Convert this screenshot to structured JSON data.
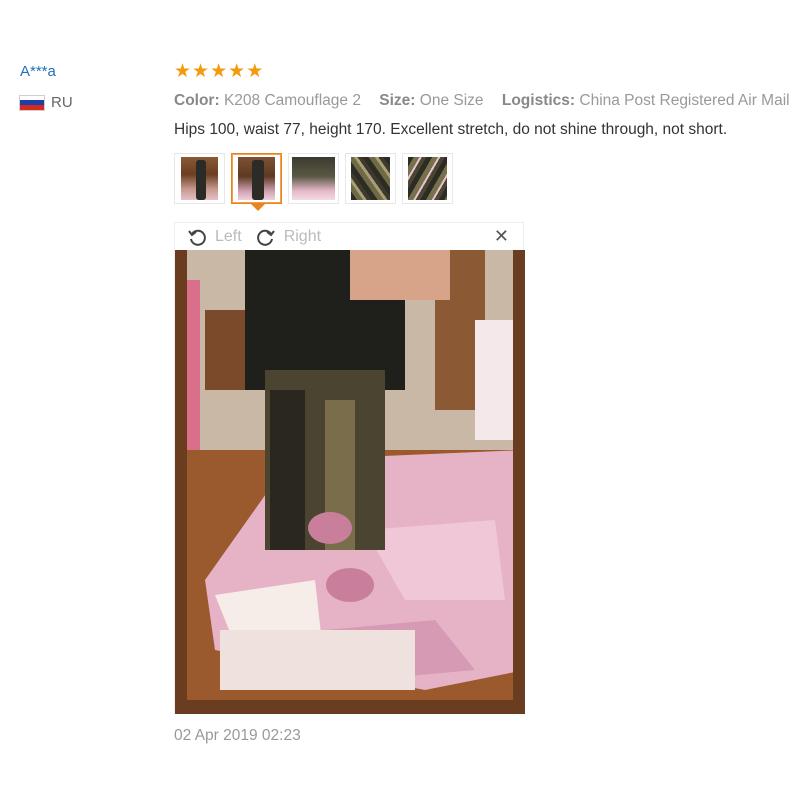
{
  "reviewer": {
    "name": "A***a",
    "country": "RU",
    "flag_colors": [
      "#ffffff",
      "#1c3fa8",
      "#d52b1e"
    ]
  },
  "review": {
    "rating": 5,
    "star_color": "#f59a0e",
    "color_key": "Color:",
    "color_value": "K208 Camouflage 2",
    "size_key": "Size:",
    "size_value": "One Size",
    "logistics_key": "Logistics:",
    "logistics_value": "China Post Registered Air Mail",
    "text": "Hips 100, waist 77, height 170. Excellent stretch, do not shine through, not short.",
    "date": "02 Apr 2019 02:23"
  },
  "photos": {
    "count": 5,
    "active_index": 1,
    "active_border_color": "#e8851f"
  },
  "viewer": {
    "left_label": "Left",
    "right_label": "Right",
    "close_icon": "close-icon"
  }
}
